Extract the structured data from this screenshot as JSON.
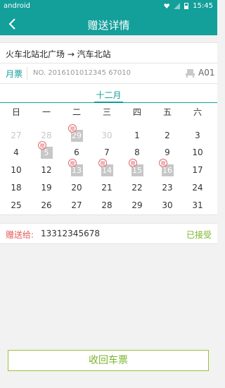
{
  "status_bar": {
    "carrier": "android",
    "time": "15:45"
  },
  "header": {
    "title": "赠送详情"
  },
  "route": {
    "text": "火车北站北广场 → 汽车北站"
  },
  "ticket": {
    "type": "月票",
    "number": "NO. 2016101012345 67010",
    "seat": "A01"
  },
  "calendar": {
    "month": "十二月",
    "weekdays": [
      "日",
      "一",
      "二",
      "三",
      "四",
      "五",
      "六"
    ],
    "gift_badge": "赠",
    "rows": [
      [
        {
          "d": "27",
          "muted": true
        },
        {
          "d": "28",
          "muted": true
        },
        {
          "d": "29",
          "gift": true
        },
        {
          "d": "30",
          "muted": true
        },
        {
          "d": "1"
        },
        {
          "d": "2"
        },
        {
          "d": "3"
        }
      ],
      [
        {
          "d": "4"
        },
        {
          "d": "5",
          "gift": true
        },
        {
          "d": "6"
        },
        {
          "d": "7"
        },
        {
          "d": "8"
        },
        {
          "d": "9"
        },
        {
          "d": "10"
        }
      ],
      [
        {
          "d": "10"
        },
        {
          "d": "12"
        },
        {
          "d": "13",
          "gift": true
        },
        {
          "d": "14",
          "gift": true
        },
        {
          "d": "15",
          "gift": true
        },
        {
          "d": "16",
          "gift": true
        },
        {
          "d": "17"
        }
      ],
      [
        {
          "d": "18"
        },
        {
          "d": "19"
        },
        {
          "d": "20"
        },
        {
          "d": "21"
        },
        {
          "d": "22"
        },
        {
          "d": "23"
        },
        {
          "d": "24"
        }
      ],
      [
        {
          "d": "25"
        },
        {
          "d": "26"
        },
        {
          "d": "27"
        },
        {
          "d": "28"
        },
        {
          "d": "29"
        },
        {
          "d": "30"
        },
        {
          "d": "31"
        }
      ]
    ]
  },
  "recipient": {
    "label": "赠送给:",
    "phone": "13312345678",
    "status": "已接受"
  },
  "actions": {
    "recall_label": "收回车票"
  },
  "colors": {
    "accent": "#139f9a",
    "gift_red": "#e06a6a",
    "accept_green": "#7ab52a"
  }
}
